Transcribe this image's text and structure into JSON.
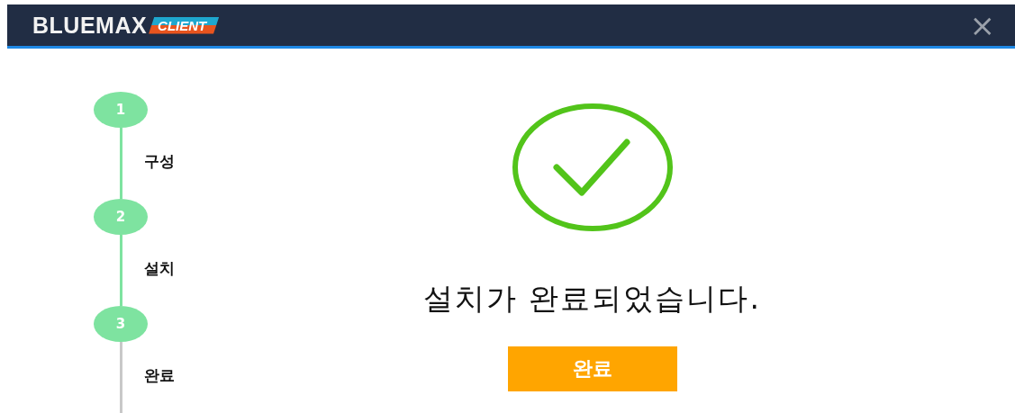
{
  "header": {
    "logo_main": "BLUEMAX",
    "logo_badge": "CLIENT",
    "close": "×"
  },
  "steps": [
    {
      "number": "1",
      "label": "구성",
      "done": true
    },
    {
      "number": "2",
      "label": "설치",
      "done": true
    },
    {
      "number": "3",
      "label": "완료",
      "done": true
    }
  ],
  "message": "설치가 완료되었습니다.",
  "button": "완료"
}
